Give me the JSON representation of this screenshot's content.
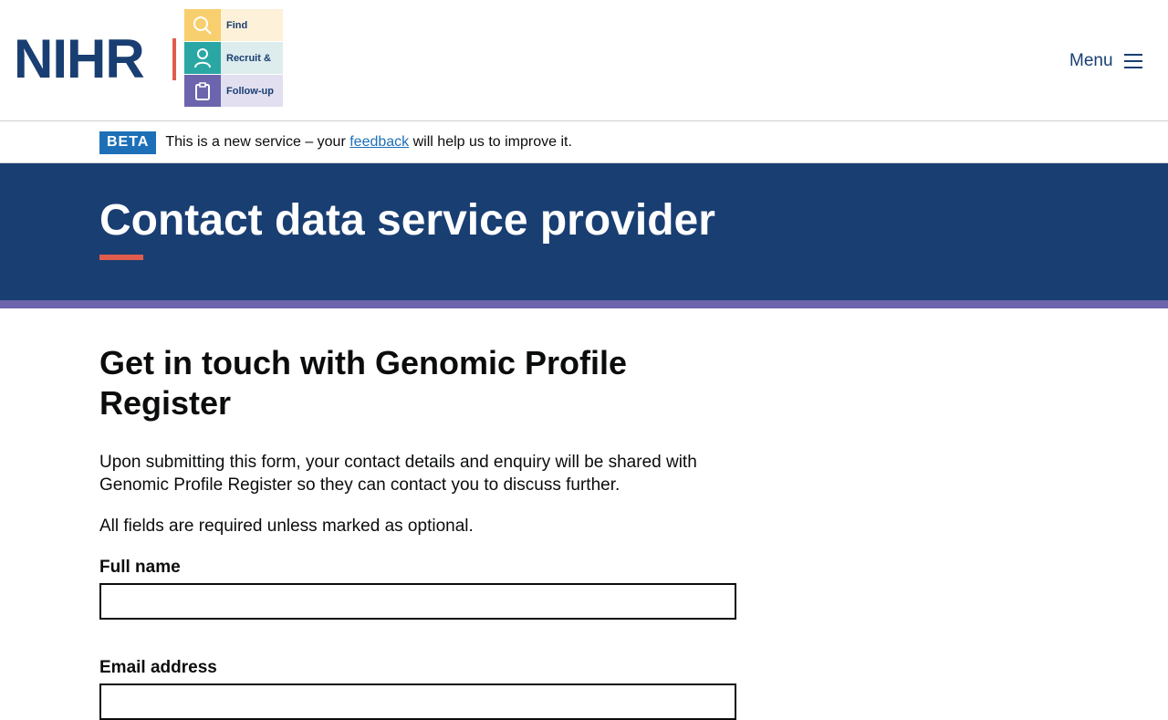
{
  "header": {
    "logo_text": "NIHR",
    "frf": [
      {
        "icon": "search-icon",
        "label": "Find",
        "icon_bg": "#f8cf6e",
        "text_bg": "#fdf1d9"
      },
      {
        "icon": "person-icon",
        "label": "Recruit &",
        "icon_bg": "#2aa7a4",
        "text_bg": "#ddecec"
      },
      {
        "icon": "clipboard-icon",
        "label": "Follow-up",
        "icon_bg": "#6c64ac",
        "text_bg": "#e1dff0"
      }
    ],
    "menu_label": "Menu",
    "menu_icon": "hamburger-icon"
  },
  "beta": {
    "tag": "BETA",
    "text_before": "This is a new service – your",
    "link_text": "feedback",
    "text_after": "will help us to improve it."
  },
  "hero": {
    "title": "Contact data service provider"
  },
  "main": {
    "heading": "Get in touch with Genomic Profile Register",
    "intro": "Upon submitting this form, your contact details and enquiry will be shared with Genomic Profile Register so they can contact you to discuss further.",
    "required_note": "All fields are required unless marked as optional.",
    "fields": [
      {
        "label": "Full name",
        "value": ""
      },
      {
        "label": "Email address",
        "value": ""
      }
    ]
  },
  "colors": {
    "brand_navy": "#193e72",
    "accent_red": "#e05d4d",
    "purple_band": "#6c64ac",
    "link_blue": "#1d70b8"
  }
}
